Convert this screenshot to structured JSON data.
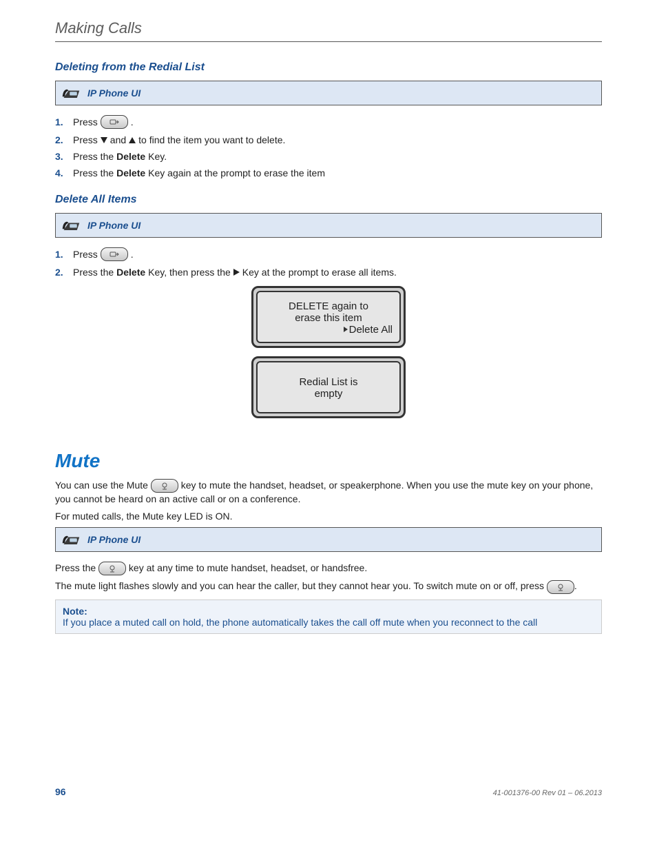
{
  "chapter": "Making Calls",
  "section1": {
    "title": "Deleting from the Redial List",
    "uiLabel": "IP Phone UI",
    "steps": {
      "s1a": "Press",
      "s1b": ".",
      "s2a": "Press",
      "s2b": "and",
      "s2c": "to find the item you want to delete.",
      "s3a": "Press the",
      "s3b": "Delete",
      "s3c": "Key.",
      "s4a": "Press the",
      "s4b": "Delete",
      "s4c": "Key again at the prompt to erase the item"
    }
  },
  "section2": {
    "title": "Delete All Items",
    "uiLabel": "IP Phone UI",
    "steps": {
      "s1a": "Press",
      "s1b": ".",
      "s2a": "Press the",
      "s2b": "Delete",
      "s2c": "Key, then press the",
      "s2d": "Key at the prompt to erase all items."
    },
    "lcd1": {
      "l1": "DELETE again to",
      "l2": "erase this item",
      "l3": "Delete All"
    },
    "lcd2": {
      "l1": "Redial List is",
      "l2": "empty"
    }
  },
  "mute": {
    "title": "Mute",
    "p1a": "You can use the Mute",
    "p1b": "key to mute the handset, headset, or speakerphone. When you use the mute key on your phone, you cannot be heard on an active call or on a conference.",
    "p2": "For muted calls, the Mute key LED is ON.",
    "uiLabel": "IP Phone UI",
    "p3a": "Press the",
    "p3b": "key at any time to mute handset, headset, or handsfree.",
    "p4a": "The mute light flashes slowly and you can hear the caller, but they cannot hear you. To switch mute on or off, press",
    "p4b": ".",
    "noteLabel": "Note:",
    "noteBody": "If you place a muted call on hold, the phone automatically takes the call off mute when you reconnect to the call"
  },
  "footer": {
    "page": "96",
    "docid": "41-001376-00 Rev 01 – 06.2013"
  }
}
